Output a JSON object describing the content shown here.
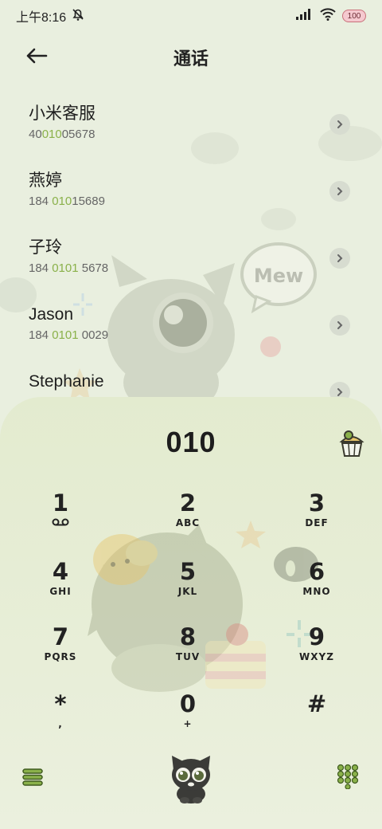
{
  "status_bar": {
    "time": "上午8:16",
    "battery": "100"
  },
  "header": {
    "title": "通话"
  },
  "contacts": [
    {
      "name": "小米客服",
      "number_pre": "40",
      "number_hl": "010",
      "number_post": "05678"
    },
    {
      "name": "燕婷",
      "number_pre": "184 ",
      "number_hl": "010",
      "number_post": "15689"
    },
    {
      "name": "子玲",
      "number_pre": "184 ",
      "number_hl": "0101",
      "number_post": " 5678"
    },
    {
      "name": "Jason",
      "number_pre": "184 ",
      "number_hl": "0101",
      "number_post": " 0029"
    },
    {
      "name": "Stephanie",
      "number_pre": "",
      "number_hl": "",
      "number_post": ""
    }
  ],
  "bubble_text": "Mew",
  "dialer": {
    "number": "010"
  },
  "keys": [
    {
      "digit": "1",
      "letters": ""
    },
    {
      "digit": "2",
      "letters": "ABC"
    },
    {
      "digit": "3",
      "letters": "DEF"
    },
    {
      "digit": "4",
      "letters": "GHI"
    },
    {
      "digit": "5",
      "letters": "JKL"
    },
    {
      "digit": "6",
      "letters": "MNO"
    },
    {
      "digit": "7",
      "letters": "PQRS"
    },
    {
      "digit": "8",
      "letters": "TUV"
    },
    {
      "digit": "9",
      "letters": "WXYZ"
    },
    {
      "digit": "*",
      "letters": ","
    },
    {
      "digit": "0",
      "letters": "+"
    },
    {
      "digit": "#",
      "letters": ""
    }
  ],
  "colors": {
    "background": "#e9efdf",
    "dialer_bg": "#e3ebcf",
    "accent_green": "#8ab14a"
  },
  "icons": {
    "back": "arrow-left-icon",
    "chevron": "chevron-right-icon",
    "voicemail": "voicemail-icon",
    "menu": "menu-icon",
    "call": "cat-call-icon",
    "keypad": "keypad-grid-icon",
    "cupcake": "cupcake-icon"
  }
}
